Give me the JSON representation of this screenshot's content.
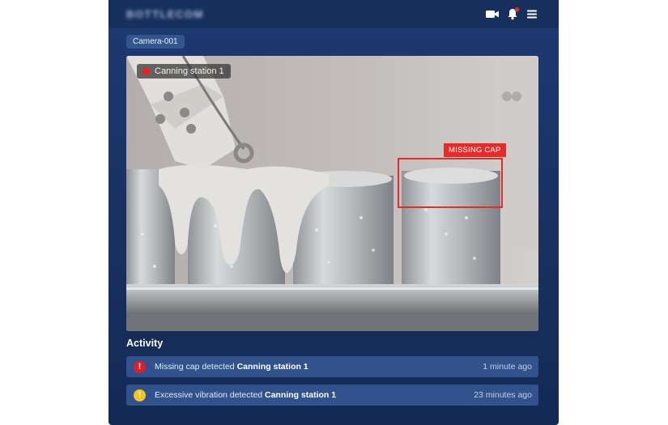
{
  "app": {
    "logo_text": "BOTTLECOM"
  },
  "header": {
    "icons": [
      "video-camera-icon",
      "bell-icon",
      "menu-icon"
    ],
    "notification_dot_color": "#e62b2b"
  },
  "camera": {
    "tag_label": "Camera-001",
    "station_label": "Canning station 1",
    "live_indicator_color": "#ee1f1f",
    "detection": {
      "label": "MISSING CAP",
      "color": "#e62b2b"
    }
  },
  "activity": {
    "title": "Activity",
    "items": [
      {
        "icon": "error-icon",
        "icon_color": "#e11d2a",
        "prefix": "Missing cap detected",
        "station": "Canning station 1",
        "time": "1 minute ago"
      },
      {
        "icon": "warning-icon",
        "icon_color": "#f5c51b",
        "prefix": "Excessive vibration detected",
        "station": "Canning station 1",
        "time": "23 minutes ago"
      }
    ]
  }
}
